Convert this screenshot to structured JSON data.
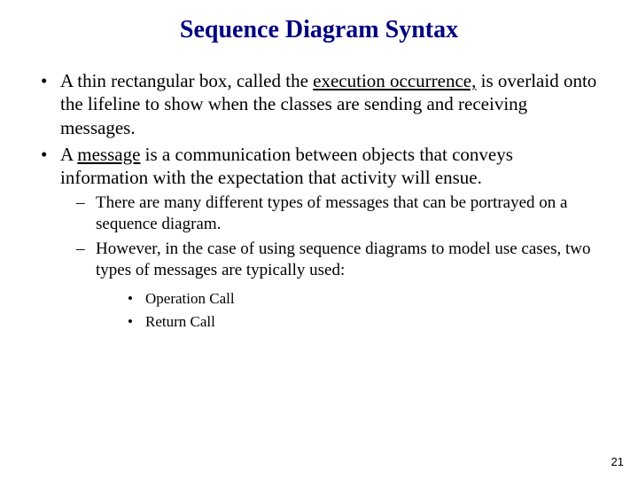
{
  "title": "Sequence Diagram Syntax",
  "bullets": {
    "b1a": "A thin rectangular box, called the ",
    "b1u": "execution occurrence,",
    "b1b": " is overlaid onto the lifeline to show when the classes are sending and receiving messages.",
    "b2a": "A ",
    "b2u": "message",
    "b2b": " is a communication between objects that conveys information with the expectation that activity will ensue.",
    "b2s1": "There are many different types of messages that can be portrayed on a sequence diagram.",
    "b2s2": "However, in the case of using sequence diagrams to model use cases, two types of messages are typically used:",
    "b2s2s1": "Operation Call",
    "b2s2s2": "Return Call"
  },
  "pageNumber": "21"
}
